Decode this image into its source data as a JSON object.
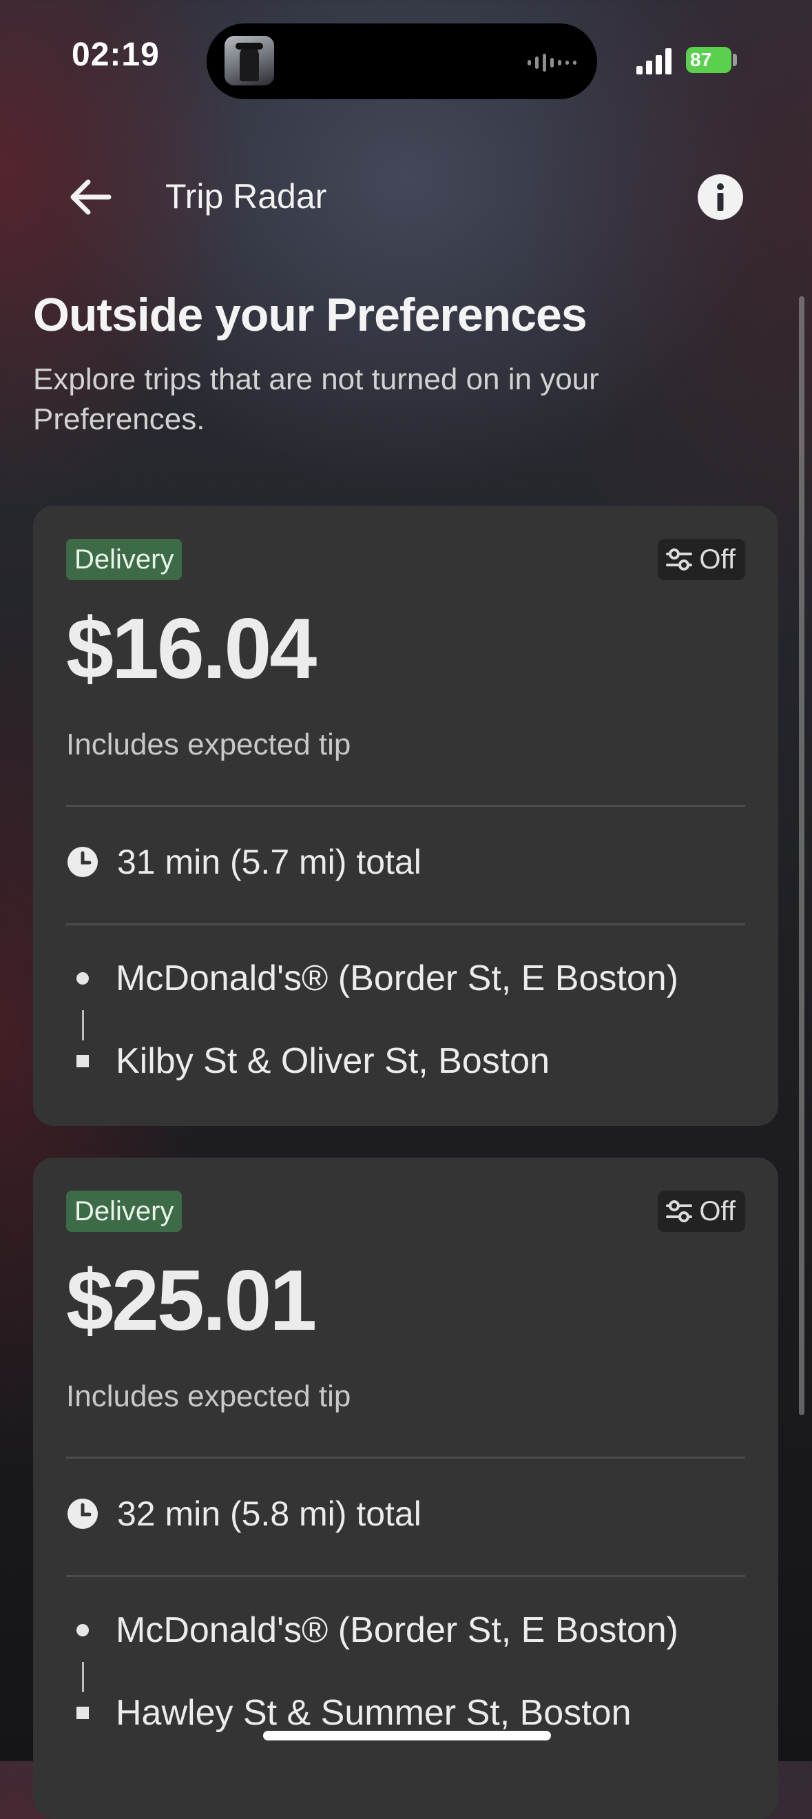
{
  "status_bar": {
    "time": "02:19",
    "battery": "87",
    "battery_color": "#5bd04f"
  },
  "header": {
    "title": "Trip Radar",
    "back_icon": "arrow-left-icon",
    "info_icon": "info-circle-icon"
  },
  "section": {
    "title": "Outside your Preferences",
    "subtitle": "Explore trips that are not turned on in your Preferences."
  },
  "colors": {
    "card_background": "#343434",
    "delivery_tag": "#3d6a47"
  },
  "trips": [
    {
      "type": "Delivery",
      "preference_status": "Off",
      "fare": "$16.04",
      "fare_note": "Includes expected tip",
      "duration": "31 min (5.7 mi) total",
      "pickup": "McDonald's® (Border St, E Boston)",
      "dropoff": "Kilby St & Oliver St, Boston"
    },
    {
      "type": "Delivery",
      "preference_status": "Off",
      "fare": "$25.01",
      "fare_note": "Includes expected tip",
      "duration": "32 min (5.8 mi) total",
      "pickup": "McDonald's® (Border St, E Boston)",
      "dropoff": "Hawley St & Summer St, Boston"
    }
  ]
}
